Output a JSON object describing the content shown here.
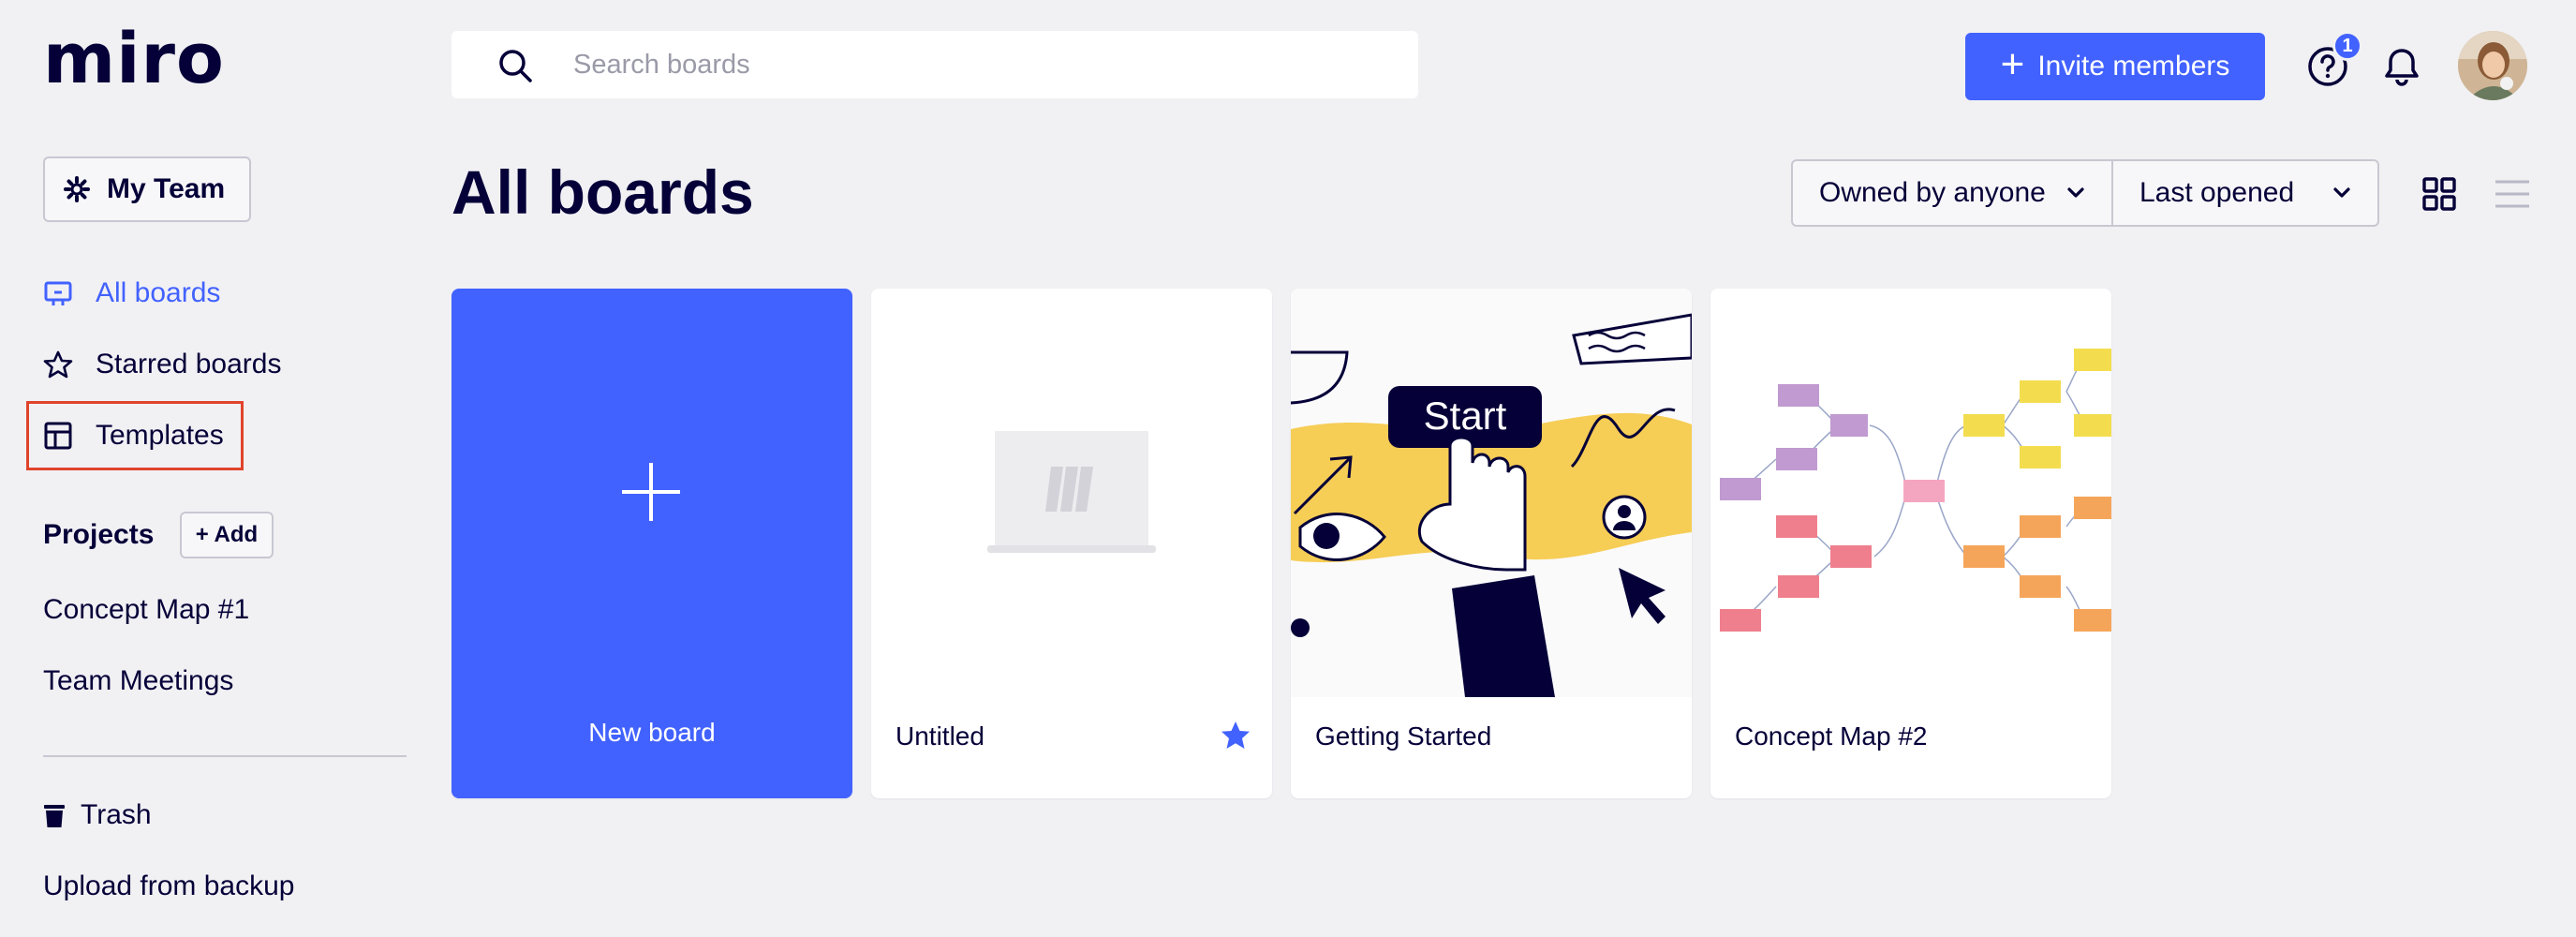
{
  "app": {
    "logo": "miro"
  },
  "search": {
    "placeholder": "Search boards"
  },
  "header": {
    "invite_label": "Invite members",
    "help_badge": "1"
  },
  "sidebar": {
    "team_label": "My Team",
    "nav": [
      {
        "label": "All boards",
        "icon": "board-icon",
        "active": true
      },
      {
        "label": "Starred boards",
        "icon": "star-icon"
      },
      {
        "label": "Templates",
        "icon": "template-icon",
        "highlighted": true
      }
    ],
    "projects_title": "Projects",
    "add_label": "+ Add",
    "projects": [
      "Concept Map #1",
      "Team Meetings"
    ],
    "trash_label": "Trash",
    "upload_label": "Upload from backup"
  },
  "main": {
    "title": "All boards",
    "owner_filter": "Owned by anyone",
    "sort_filter": "Last opened",
    "new_board_label": "New board",
    "boards": [
      {
        "title": "Untitled",
        "starred": true
      },
      {
        "title": "Getting Started",
        "starred": false,
        "thumb_text": "Start"
      },
      {
        "title": "Concept Map #2",
        "starred": false
      }
    ]
  },
  "colors": {
    "accent": "#4262ff",
    "text": "#050038",
    "background": "#f1f1f4",
    "highlight_border": "#e0442b",
    "yellow": "#f6cd55"
  }
}
